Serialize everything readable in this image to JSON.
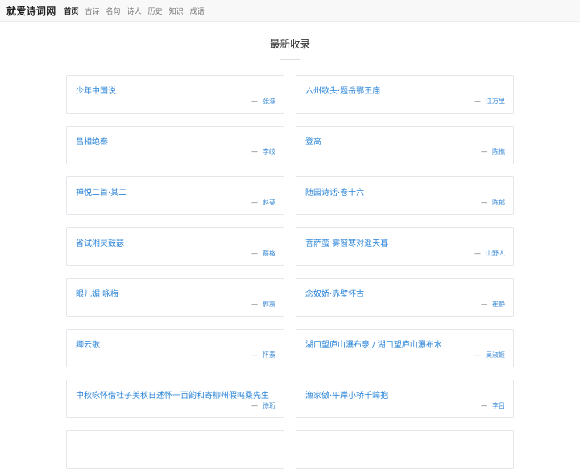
{
  "nav": {
    "brand": "就爱诗词网",
    "links": [
      "首页",
      "古诗",
      "名句",
      "诗人",
      "历史",
      "知识",
      "成语"
    ]
  },
  "section": {
    "title": "最新收录"
  },
  "cards": [
    {
      "title": "少年中国说",
      "author": "张滋"
    },
    {
      "title": "六州歌头·题岳鄂王庙",
      "author": "江万里"
    },
    {
      "title": "吕相绝秦",
      "author": "李峧"
    },
    {
      "title": "登高",
      "author": "陈樵"
    },
    {
      "title": "禅悦二首·其二",
      "author": "赵葵"
    },
    {
      "title": "随园诗话·卷十六",
      "author": "陈郁"
    },
    {
      "title": "省试湘灵鼓瑟",
      "author": "蔡格"
    },
    {
      "title": "菩萨蛮·雾窗寒对遥天暮",
      "author": "山野人"
    },
    {
      "title": "眼儿媚·咏梅",
      "author": "郭震"
    },
    {
      "title": "念奴娇·赤壁怀古",
      "author": "崔静"
    },
    {
      "title": "卿云歌",
      "author": "怀素"
    },
    {
      "title": "湖口望庐山瀑布泉 / 湖口望庐山瀑布水",
      "author": "吴淑姬"
    },
    {
      "title": "中秋咏怀借杜子美秋日述怀一百韵和寄柳州假鸣桑先生",
      "author": "徐珩"
    },
    {
      "title": "渔家傲·平岸小桥千嶂抱",
      "author": "李吕"
    },
    {
      "title": "",
      "author": ""
    },
    {
      "title": "",
      "author": ""
    }
  ],
  "dash_glyph": "—"
}
